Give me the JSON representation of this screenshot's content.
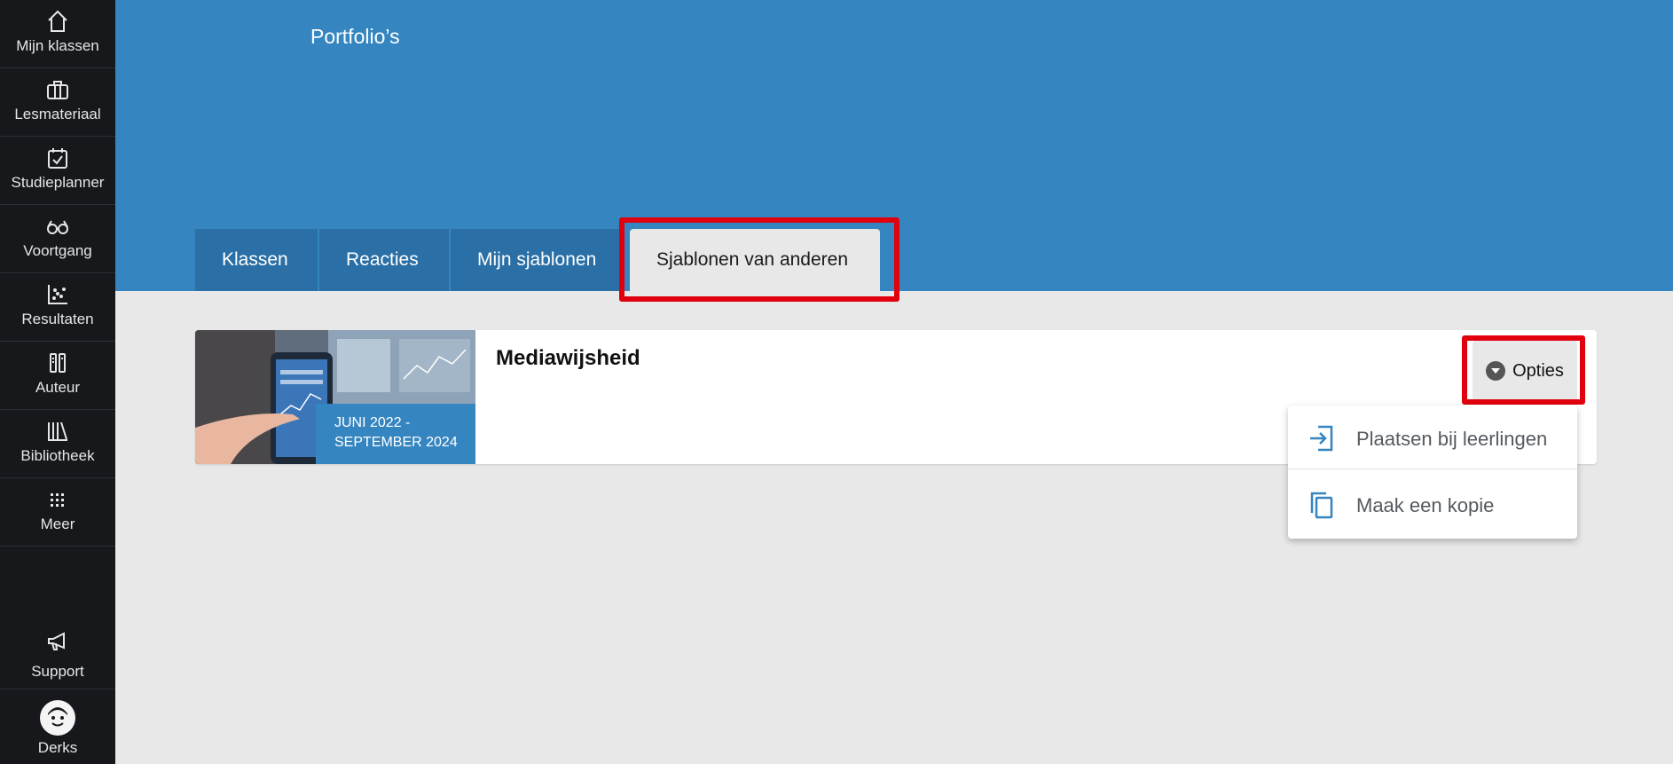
{
  "sidebar": {
    "items": [
      {
        "label": "Mijn klassen",
        "icon": "home-icon"
      },
      {
        "label": "Lesmateriaal",
        "icon": "briefcase-icon"
      },
      {
        "label": "Studieplanner",
        "icon": "calendar-check-icon"
      },
      {
        "label": "Voortgang",
        "icon": "glasses-icon"
      },
      {
        "label": "Resultaten",
        "icon": "scatter-chart-icon"
      },
      {
        "label": "Auteur",
        "icon": "author-tools-icon"
      },
      {
        "label": "Bibliotheek",
        "icon": "books-icon"
      },
      {
        "label": "Meer",
        "icon": "grid-icon"
      }
    ],
    "support_label": "Support",
    "user_label": "Derks"
  },
  "header": {
    "title": "Portfolio’s"
  },
  "tabs": [
    {
      "label": "Klassen"
    },
    {
      "label": "Reacties"
    },
    {
      "label": "Mijn sjablonen"
    },
    {
      "label": "Sjablonen van anderen",
      "active": true
    }
  ],
  "card": {
    "title": "Mediawijsheid",
    "date_line1": "JUNI 2022 -",
    "date_line2": "SEPTEMBER 2024",
    "options_label": "Opties"
  },
  "menu": {
    "items": [
      {
        "label": "Plaatsen bij leerlingen",
        "icon": "place-with-students-icon"
      },
      {
        "label": "Maak een kopie",
        "icon": "copy-icon"
      }
    ]
  },
  "colors": {
    "accent_blue": "#3585c0",
    "tab_blue": "#2a6fa5",
    "sidebar_bg": "#16181c",
    "highlight_red": "#e0000e",
    "page_bg": "#e8e8e8"
  }
}
